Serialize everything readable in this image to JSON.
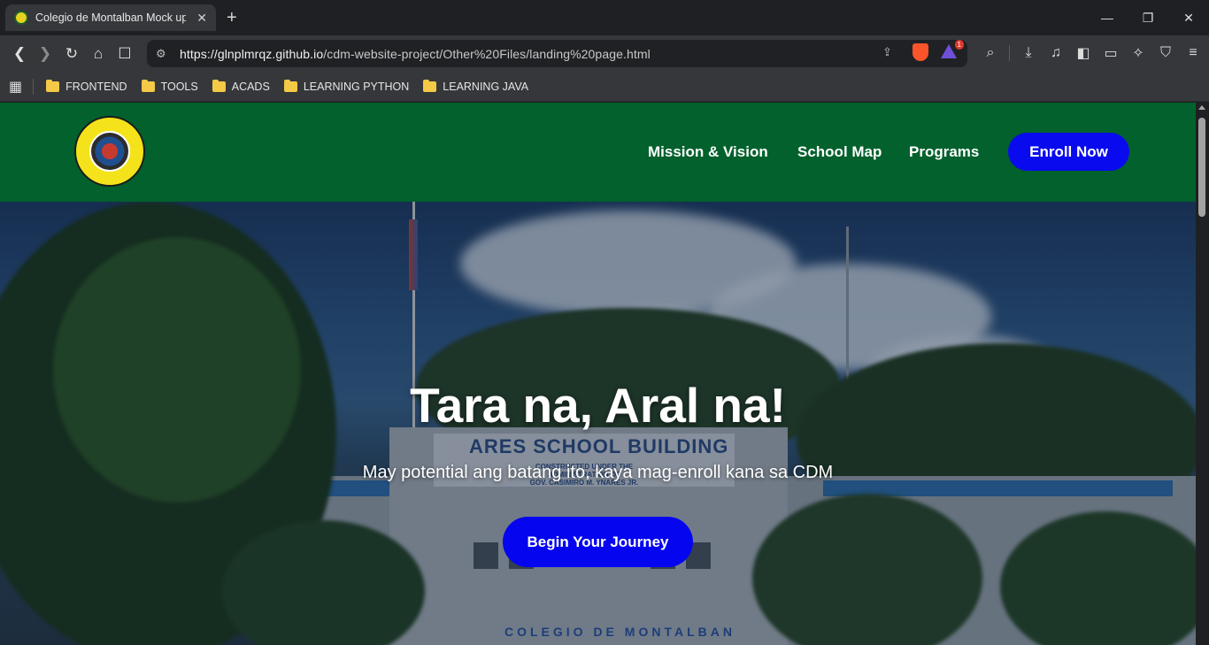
{
  "browser": {
    "tab_title": "Colegio de Montalban Mock up",
    "tab_close": "✕",
    "new_tab": "+",
    "window": {
      "minimize": "—",
      "maximize": "❐",
      "close": "✕"
    },
    "url_host": "https://glnplmrqz.github.io",
    "url_path": "/cdm-website-project/Other%20Files/landing%20page.html",
    "rewards_badge": "1",
    "bookmarks": [
      "FRONTEND",
      "TOOLS",
      "ACADS",
      "LEARNING PYTHON",
      "LEARNING JAVA"
    ]
  },
  "site": {
    "nav": {
      "mission": "Mission & Vision",
      "map": "School Map",
      "programs": "Programs",
      "enroll": "Enroll Now"
    },
    "hero": {
      "title": "Tara na, Aral na!",
      "subtitle": "May potential ang batang ito, kaya mag-enroll kana sa CDM",
      "cta": "Begin Your Journey"
    },
    "photo_sign": "COLEGIO DE MONTALBAN",
    "building_sign": "ARES SCHOOL BUILDING",
    "building_sub_1": "CONSTRUCTED UNDER THE",
    "building_sub_2": "ADMINISTRATION OF",
    "building_sub_3": "GOV. CASIMIRO M. YNARES JR."
  },
  "colors": {
    "header_green": "#02612c",
    "button_blue": "#0a0aee"
  }
}
